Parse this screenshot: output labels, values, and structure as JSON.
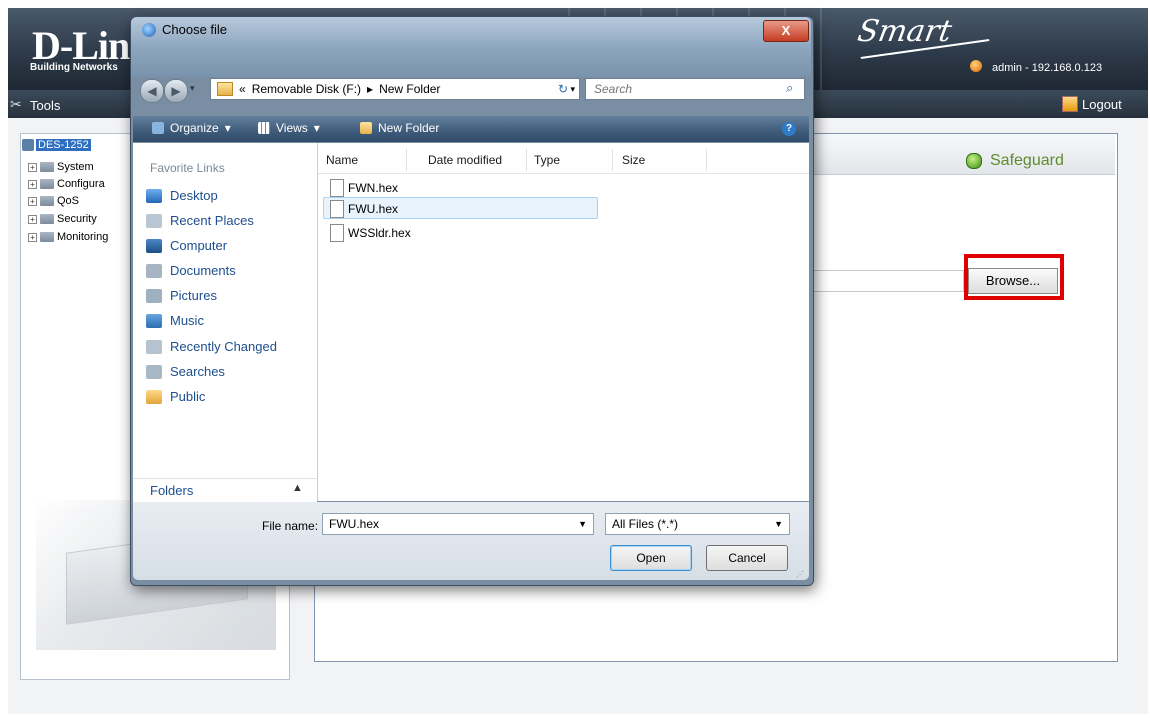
{
  "header": {
    "brand": "D-Lin",
    "tagline": "Building Networks",
    "product": "Smart",
    "user": "admin - 192.168.0.123"
  },
  "toolbar": {
    "tools_label": "Tools",
    "logout_label": "Logout"
  },
  "tree": {
    "root": "DES-1252",
    "items": [
      "System",
      "Configura",
      "QoS",
      "Security",
      "Monitoring"
    ]
  },
  "content": {
    "safeguard_label": "Safeguard",
    "browse_label": "Browse..."
  },
  "dialog": {
    "title": "Choose file",
    "close_glyph": "X",
    "address": {
      "prefix": "«",
      "segment1": "Removable Disk (F:)",
      "separator": "▸",
      "segment2": "New Folder"
    },
    "search_placeholder": "Search",
    "commands": {
      "organize": "Organize",
      "views": "Views",
      "new_folder": "New Folder"
    },
    "favorites_heading": "Favorite Links",
    "favorites": [
      "Desktop",
      "Recent Places",
      "Computer",
      "Documents",
      "Pictures",
      "Music",
      "Recently Changed",
      "Searches",
      "Public"
    ],
    "folders_label": "Folders",
    "columns": [
      "Name",
      "Date modified",
      "Type",
      "Size"
    ],
    "files": [
      "FWN.hex",
      "FWU.hex",
      "WSSldr.hex"
    ],
    "selected_file": "FWU.hex",
    "file_name_label": "File name:",
    "file_name_value": "FWU.hex",
    "file_type_value": "All Files (*.*)",
    "open_label": "Open",
    "cancel_label": "Cancel"
  },
  "colors": {
    "header_bg": "#2d3a49",
    "highlight": "#e00000",
    "link": "#1c4f8e",
    "safeguard": "#5f8a2e"
  }
}
